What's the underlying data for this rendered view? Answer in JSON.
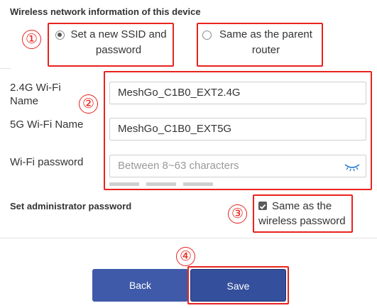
{
  "section_title": "Wireless network information of this device",
  "markers": [
    "①",
    "②",
    "③",
    "④"
  ],
  "mode": {
    "new_ssid_line1": "Set a new SSID and",
    "new_ssid_line2": "password",
    "same_parent_line1": "Same as the parent",
    "same_parent_line2": "router",
    "selected": "new_ssid"
  },
  "fields": {
    "ssid_24_label_line1": "2.4G Wi-Fi",
    "ssid_24_label_line2": "Name",
    "ssid_24_value": "MeshGo_C1B0_EXT2.4G",
    "ssid_5_label": "5G Wi-Fi Name",
    "ssid_5_value": "MeshGo_C1B0_EXT5G",
    "password_label": "Wi-Fi password",
    "password_placeholder": "Between 8~63 characters"
  },
  "admin": {
    "label": "Set administrator password",
    "checkbox_line1": "Same as the",
    "checkbox_line2": "wireless password",
    "checked": true
  },
  "buttons": {
    "back": "Back",
    "save": "Save"
  },
  "colors": {
    "annotation_red": "#e8231e",
    "button_blue": "#3f5aa8",
    "save_blue": "#34509c"
  }
}
